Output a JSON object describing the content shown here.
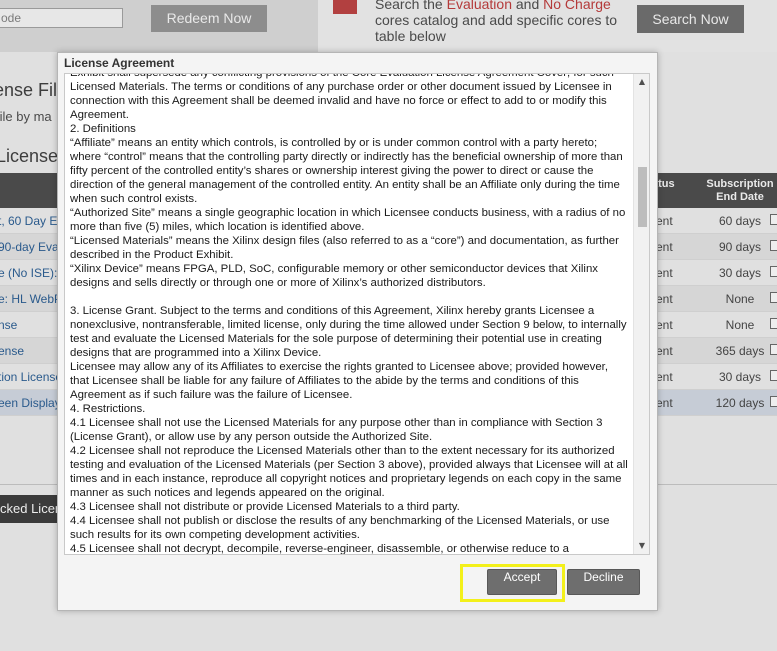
{
  "background": {
    "code_input_value": "ode",
    "redeem_label": "Redeem Now",
    "eval_text": {
      "prefix": "Search the ",
      "evaluation": "Evaluation",
      "and": " and ",
      "no_charge": "No Charge",
      "suffix": " cores catalog and add specific cores to table below"
    },
    "search_label": "Search Now",
    "heading1": "ense File",
    "sub1": "file by ma",
    "heading2": "License",
    "table": {
      "header_status": "atus",
      "header_sub_line1": "Subscription",
      "header_sub_line2": "End Date",
      "rows": [
        {
          "name": "t, 60 Day E",
          "status": "ent",
          "end": "60 days"
        },
        {
          "name": "90-day Eval",
          "status": "ent",
          "end": "90 days"
        },
        {
          "name": "e (No ISE):",
          "status": "ent",
          "end": "30 days"
        },
        {
          "name": "e: HL WebP",
          "status": "ent",
          "end": "None"
        },
        {
          "name": "nse",
          "status": "ent",
          "end": "None"
        },
        {
          "name": "ense",
          "status": "ent",
          "end": "365 days"
        },
        {
          "name": "tion License",
          "status": "ent",
          "end": "30 days"
        },
        {
          "name": "een Display",
          "status": "ent",
          "end": "120 days"
        }
      ]
    },
    "locked_label": "cked Licen"
  },
  "modal": {
    "title": "License Agreement",
    "accept_label": "Accept",
    "decline_label": "Decline",
    "paragraphs": [
      "Exhibit shall supersede any conflicting provisions of the Core Evaluation License Agreement Cover; for such Licensed Materials.  The terms or conditions of any purchase order or other document issued by Licensee in connection with this Agreement shall be deemed invalid and have no force or effect to add to or modify this Agreement.",
      "2.      Definitions",
      "“Affiliate” means an entity which controls, is controlled by or is under common control with a party hereto; where “control” means that the controlling party directly or indirectly has the beneficial ownership of more than fifty percent of the controlled entity’s shares or ownership interest giving the power to direct or cause the direction of the general management of the controlled entity.  An entity shall be an Affiliate only during the time when such control exists.",
      "“Authorized Site” means a single geographic location in which Licensee conducts business, with a radius of no more than five (5) miles, which location is identified above.",
      "“Licensed Materials” means the Xilinx design files (also referred to as a “core”) and documentation, as further described in the Product Exhibit.",
      "“Xilinx Device” means FPGA, PLD, SoC, configurable memory or other semiconductor devices that Xilinx designs and sells directly or through one or more of Xilinx’s authorized distributors.",
      "",
      "3.      License Grant.  Subject to the terms and conditions of this Agreement, Xilinx hereby grants Licensee a nonexclusive, nontransferable, limited license, only during the time allowed under Section 9 below, to internally test and evaluate the Licensed Materials for the sole purpose of determining their potential use in creating designs that are programmed into a Xilinx Device.",
      "Licensee may allow any of its Affiliates to exercise the rights granted to Licensee above; provided however, that Licensee shall be liable for any failure of Affiliates to the abide by the terms and conditions of this Agreement as if such failure was the failure of Licensee.",
      "4.      Restrictions.",
      "4.1     Licensee shall not use the Licensed Materials for any purpose other than in compliance with Section 3 (License Grant), or allow use by any person outside the Authorized Site.",
      "4.2     Licensee shall not reproduce the Licensed Materials other than to the extent necessary for its authorized testing and evaluation of the Licensed Materials (per Section 3 above), provided always that Licensee will at all times and in each instance, reproduce all copyright notices and proprietary legends on each copy in the same manner as such notices and legends appeared on the original.",
      "4.3     Licensee shall not distribute or provide Licensed Materials to a third party.",
      "4.4     Licensee shall not publish or disclose the results of any benchmarking of the Licensed Materials, or use such results for its own competing development activities.",
      "4.5     Licensee shall not decrypt, decompile, reverse-engineer, disassemble, or otherwise reduce to a"
    ]
  }
}
